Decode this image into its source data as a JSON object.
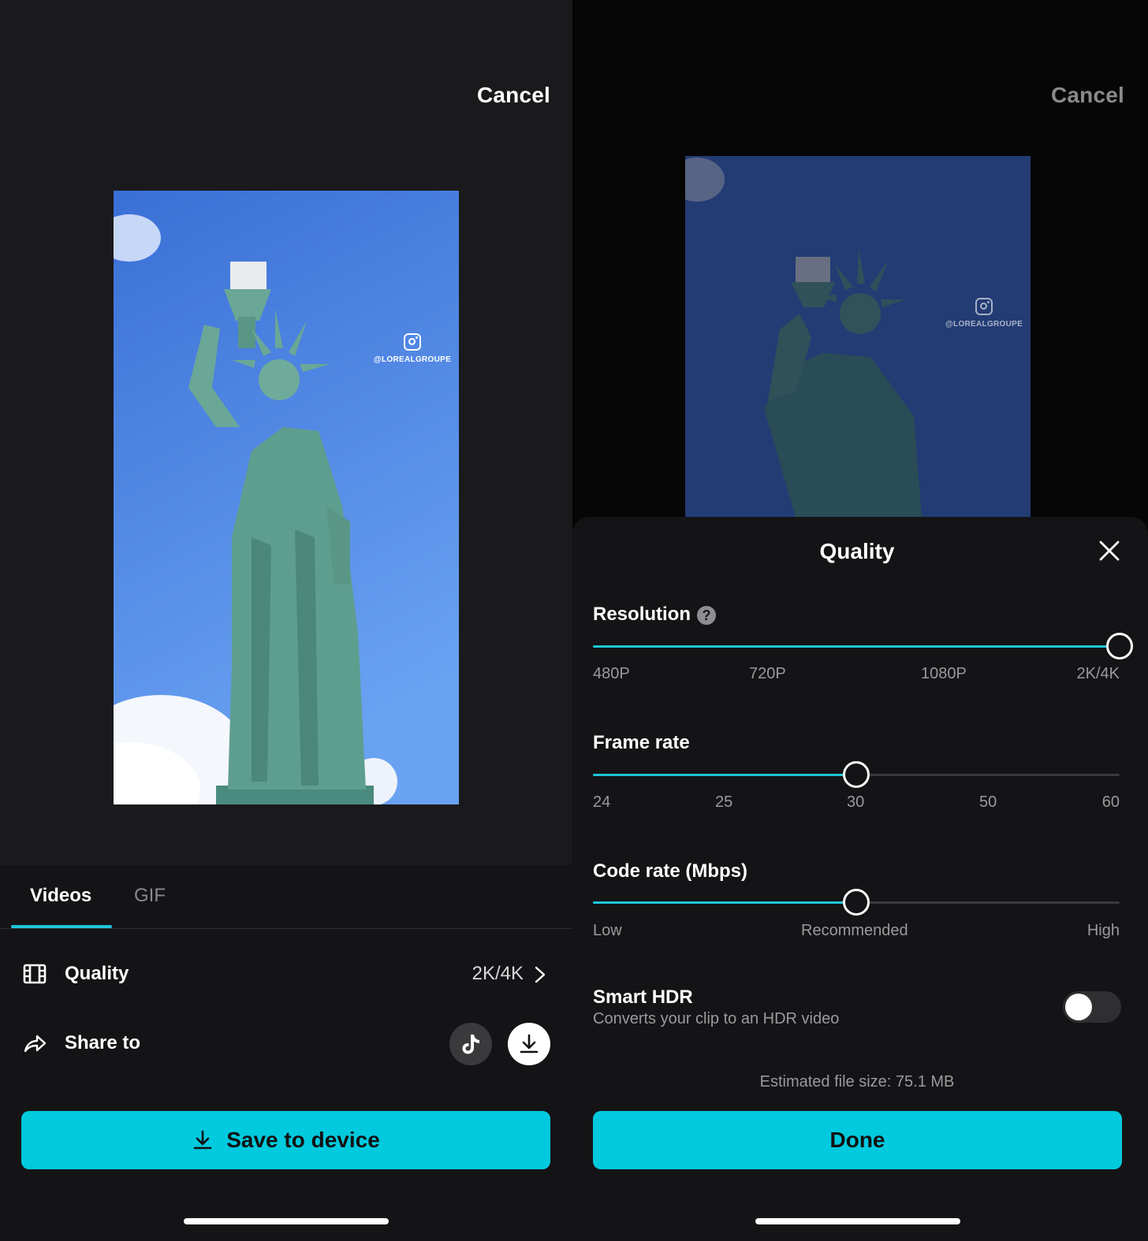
{
  "left": {
    "cancel": "Cancel",
    "watermark": "@LOREALGROUPE",
    "tabs": [
      {
        "label": "Videos",
        "active": true
      },
      {
        "label": "GIF",
        "active": false
      }
    ],
    "quality": {
      "label": "Quality",
      "value": "2K/4K",
      "icon": "film-icon"
    },
    "share": {
      "label": "Share to",
      "icon": "share-arrow-icon",
      "targets": [
        "tiktok-icon",
        "download-icon"
      ]
    },
    "save_button": "Save to device"
  },
  "right": {
    "cancel": "Cancel",
    "watermark": "@LOREALGROUPE",
    "sheet": {
      "title": "Quality",
      "resolution": {
        "label": "Resolution",
        "help": "?",
        "ticks": [
          "480P",
          "720P",
          "1080P",
          "2K/4K"
        ],
        "selected": "2K/4K"
      },
      "frame_rate": {
        "label": "Frame rate",
        "ticks": [
          "24",
          "25",
          "30",
          "50",
          "60"
        ],
        "selected": "30"
      },
      "code_rate": {
        "label": "Code rate (Mbps)",
        "ticks": [
          "Low",
          "Recommended",
          "High"
        ],
        "selected": "Recommended"
      },
      "smart_hdr": {
        "label": "Smart HDR",
        "description": "Converts your clip to an HDR video",
        "enabled": false
      },
      "file_size": "Estimated file size: 75.1 MB",
      "done_button": "Done"
    }
  },
  "colors": {
    "accent": "#01c9de",
    "track_active": "#1fc5d8",
    "background": "#1a1a1c",
    "sheet": "#141416"
  }
}
